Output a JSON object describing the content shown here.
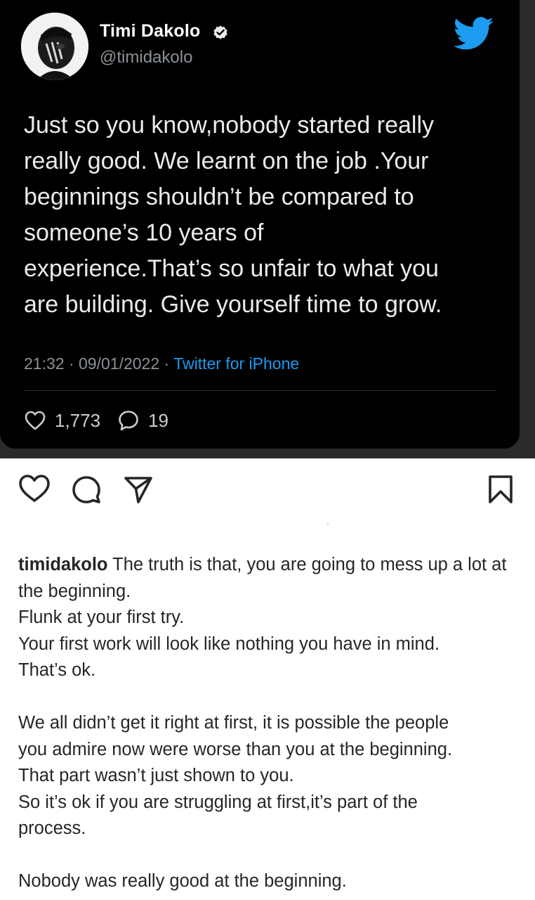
{
  "tweet": {
    "author_name": "Timi Dakolo",
    "author_handle": "@timidakolo",
    "text": "Just so you know,nobody started really\nreally good. We learnt on the job .Your\nbeginnings shouldn’t be compared to\nsomeone’s 10 years of\nexperience.That’s so unfair to what you\nare building. Give yourself time to grow.",
    "time": "21:32",
    "separator": "·",
    "date": "09/01/2022",
    "client": "Twitter for iPhone",
    "likes": "1,773",
    "replies": "19",
    "icons": {
      "avatar": "profile-photo",
      "verified": "verified-badge-icon",
      "brand": "twitter-bird-icon",
      "likes": "heart-outline-icon",
      "replies": "speech-bubble-icon"
    },
    "colors": {
      "card_background": "#000000",
      "text": "#e9ebec",
      "muted": "#8b9197",
      "accent": "#1d9bf0"
    }
  },
  "instagram": {
    "actions": {
      "like_icon": "heart-icon",
      "comment_icon": "comment-icon",
      "share_icon": "send-icon",
      "save_icon": "bookmark-icon"
    },
    "caption": {
      "username": "timidakolo",
      "paragraphs": [
        "The truth  is that, you are going to mess up a lot at the beginning.\nFlunk at your first try.\nYour first work will look like nothing you have in mind.\nThat’s ok.",
        "We all didn’t get it right at first, it is possible the people\nyou admire now were worse than you at the beginning.\nThat part wasn’t just shown to you.\nSo it’s ok if you are struggling at first,it’s part of the\nprocess.",
        "Nobody was really good at the beginning."
      ]
    }
  }
}
